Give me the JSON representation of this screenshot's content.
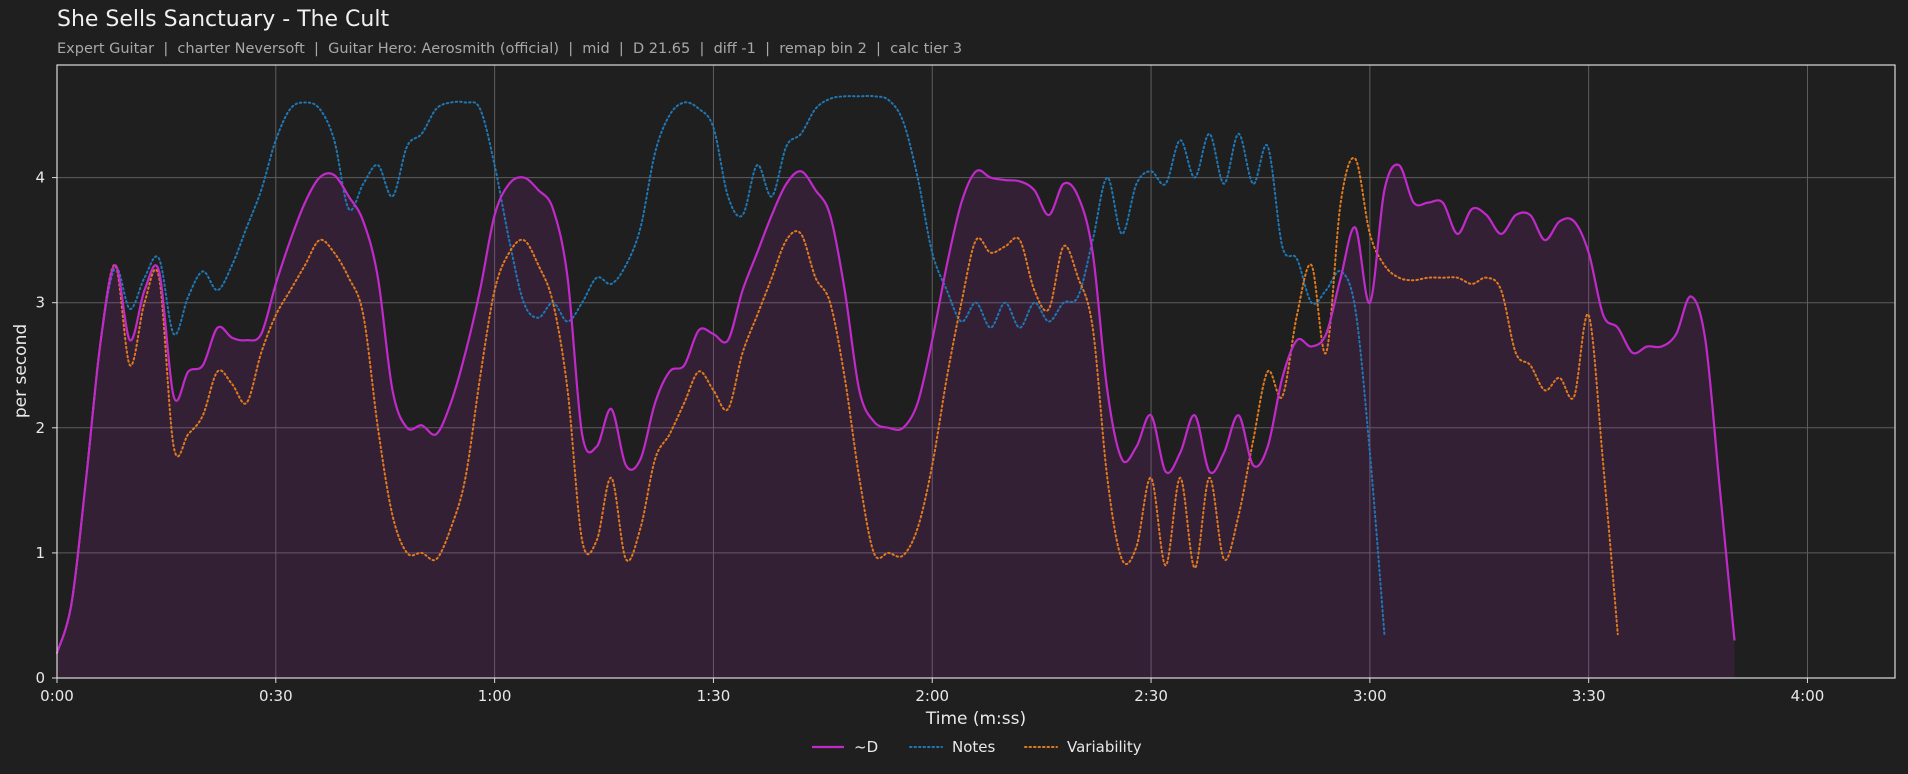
{
  "chart_data": {
    "type": "line",
    "title": "She Sells Sanctuary - The Cult",
    "subtitle": "Expert Guitar  |  charter Neversoft  |  Guitar Hero: Aerosmith (official)  |  mid  |  D 21.65  |  diff -1  |  remap bin 2  |  calc tier 3",
    "xlabel": "Time (m:ss)",
    "ylabel": "per second",
    "xlim": [
      "0:00",
      "4:12"
    ],
    "ylim": [
      0,
      4.9
    ],
    "x_ticks": [
      "0:00",
      "0:30",
      "1:00",
      "1:30",
      "2:00",
      "2:30",
      "3:00",
      "3:30",
      "4:00"
    ],
    "y_ticks": [
      "0",
      "1",
      "2",
      "3",
      "4"
    ],
    "grid": true,
    "legend_position": "bottom-center",
    "x": [
      "0:00",
      "0:02",
      "0:04",
      "0:06",
      "0:08",
      "0:10",
      "0:12",
      "0:14",
      "0:16",
      "0:18",
      "0:20",
      "0:22",
      "0:24",
      "0:26",
      "0:28",
      "0:30",
      "0:32",
      "0:34",
      "0:36",
      "0:38",
      "0:40",
      "0:42",
      "0:44",
      "0:46",
      "0:48",
      "0:50",
      "0:52",
      "0:54",
      "0:56",
      "0:58",
      "1:00",
      "1:02",
      "1:04",
      "1:06",
      "1:08",
      "1:10",
      "1:12",
      "1:14",
      "1:16",
      "1:18",
      "1:20",
      "1:22",
      "1:24",
      "1:26",
      "1:28",
      "1:30",
      "1:32",
      "1:34",
      "1:36",
      "1:38",
      "1:40",
      "1:42",
      "1:44",
      "1:46",
      "1:48",
      "1:50",
      "1:52",
      "1:54",
      "1:56",
      "1:58",
      "2:00",
      "2:02",
      "2:04",
      "2:06",
      "2:08",
      "2:10",
      "2:12",
      "2:14",
      "2:16",
      "2:18",
      "2:20",
      "2:22",
      "2:24",
      "2:26",
      "2:28",
      "2:30",
      "2:32",
      "2:34",
      "2:36",
      "2:38",
      "2:40",
      "2:42",
      "2:44",
      "2:46",
      "2:48",
      "2:50",
      "2:52",
      "2:54",
      "2:56",
      "2:58",
      "3:00",
      "3:02",
      "3:04",
      "3:06",
      "3:08",
      "3:10",
      "3:12",
      "3:14",
      "3:16",
      "3:18",
      "3:20",
      "3:22",
      "3:24",
      "3:26",
      "3:28",
      "3:30",
      "3:32",
      "3:34",
      "3:36",
      "3:38",
      "3:40",
      "3:42",
      "3:44",
      "3:46",
      "3:48",
      "3:50",
      "3:52",
      "3:54",
      "3:56",
      "3:58",
      "4:00",
      "4:02",
      "4:04",
      "4:06",
      "4:08",
      "4:10",
      "4:12"
    ],
    "series": [
      {
        "name": "~D",
        "color": "#c02ac8",
        "style": "solid",
        "fill": true,
        "values": [
          0.2,
          0.6,
          1.6,
          2.7,
          3.3,
          2.7,
          3.1,
          3.25,
          2.25,
          2.45,
          2.5,
          2.8,
          2.72,
          2.7,
          2.75,
          3.15,
          3.5,
          3.8,
          4.0,
          4.02,
          3.85,
          3.65,
          3.2,
          2.3,
          2.0,
          2.02,
          1.95,
          2.2,
          2.6,
          3.1,
          3.7,
          3.95,
          4.0,
          3.9,
          3.75,
          3.2,
          1.95,
          1.85,
          2.15,
          1.7,
          1.75,
          2.2,
          2.45,
          2.5,
          2.78,
          2.75,
          2.7,
          3.1,
          3.4,
          3.7,
          3.95,
          4.05,
          3.9,
          3.7,
          3.1,
          2.3,
          2.05,
          2.0,
          2.0,
          2.2,
          2.7,
          3.3,
          3.8,
          4.05,
          4.0,
          3.98,
          3.97,
          3.9,
          3.7,
          3.95,
          3.85,
          3.4,
          2.3,
          1.75,
          1.85,
          2.1,
          1.65,
          1.8,
          2.1,
          1.65,
          1.8,
          2.1,
          1.7,
          1.85,
          2.4,
          2.7,
          2.65,
          2.75,
          3.2,
          3.6,
          3.0,
          3.9,
          4.1,
          3.8,
          3.8,
          3.8,
          3.55,
          3.75,
          3.7,
          3.55,
          3.7,
          3.7,
          3.5,
          3.65,
          3.65,
          3.4,
          2.9,
          2.8,
          2.6,
          2.65,
          2.65,
          2.75,
          3.05,
          2.7,
          1.5,
          0.3
        ]
      },
      {
        "name": "Notes",
        "color": "#1f77b4",
        "style": "dotted",
        "fill": false,
        "values": [
          0.2,
          0.6,
          1.6,
          2.7,
          3.28,
          2.95,
          3.2,
          3.35,
          2.75,
          3.05,
          3.25,
          3.1,
          3.3,
          3.6,
          3.9,
          4.3,
          4.55,
          4.6,
          4.55,
          4.3,
          3.75,
          3.95,
          4.1,
          3.85,
          4.25,
          4.35,
          4.55,
          4.6,
          4.6,
          4.55,
          4.1,
          3.5,
          3.0,
          2.88,
          3.0,
          2.85,
          3.0,
          3.2,
          3.15,
          3.3,
          3.6,
          4.2,
          4.5,
          4.6,
          4.55,
          4.4,
          3.85,
          3.7,
          4.1,
          3.85,
          4.25,
          4.35,
          4.55,
          4.63,
          4.65,
          4.65,
          4.65,
          4.62,
          4.45,
          4.0,
          3.4,
          3.1,
          2.85,
          3.0,
          2.8,
          3.0,
          2.8,
          3.0,
          2.85,
          3.0,
          3.05,
          3.5,
          4.0,
          3.55,
          3.95,
          4.05,
          3.95,
          4.3,
          4.0,
          4.35,
          3.95,
          4.35,
          3.95,
          4.25,
          3.45,
          3.35,
          3.0,
          3.1,
          3.25,
          2.95,
          1.8,
          0.35
        ]
      },
      {
        "name": "Variability",
        "color": "#e07a1f",
        "style": "dotted",
        "fill": false,
        "values": [
          0.2,
          0.6,
          1.6,
          2.7,
          3.3,
          2.5,
          3.0,
          3.2,
          1.85,
          1.95,
          2.1,
          2.45,
          2.35,
          2.2,
          2.6,
          2.9,
          3.1,
          3.3,
          3.5,
          3.4,
          3.2,
          2.9,
          2.0,
          1.3,
          1.0,
          1.0,
          0.95,
          1.2,
          1.6,
          2.4,
          3.1,
          3.4,
          3.5,
          3.3,
          3.0,
          2.3,
          1.1,
          1.1,
          1.6,
          0.95,
          1.2,
          1.75,
          1.95,
          2.2,
          2.45,
          2.3,
          2.15,
          2.6,
          2.9,
          3.2,
          3.5,
          3.55,
          3.2,
          3.0,
          2.4,
          1.6,
          1.0,
          1.0,
          0.98,
          1.2,
          1.7,
          2.4,
          3.0,
          3.5,
          3.4,
          3.45,
          3.5,
          3.1,
          2.95,
          3.45,
          3.2,
          2.8,
          1.6,
          0.95,
          1.05,
          1.6,
          0.9,
          1.6,
          0.88,
          1.6,
          0.95,
          1.3,
          1.9,
          2.45,
          2.25,
          2.9,
          3.3,
          2.6,
          3.8,
          4.15,
          3.55,
          3.3,
          3.2,
          3.18,
          3.2,
          3.2,
          3.2,
          3.15,
          3.2,
          3.1,
          2.6,
          2.5,
          2.3,
          2.4,
          2.25,
          2.9,
          1.7,
          0.35
        ]
      }
    ]
  }
}
